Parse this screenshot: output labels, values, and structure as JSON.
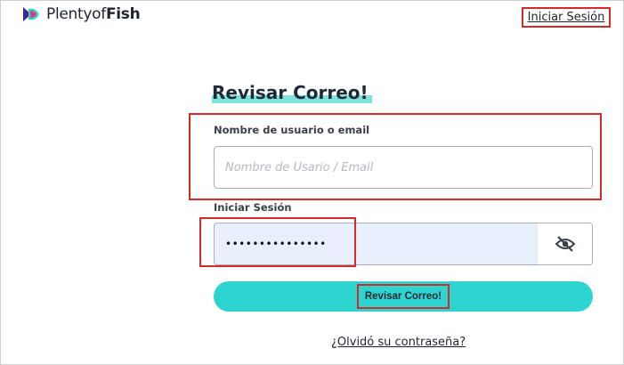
{
  "header": {
    "logo": {
      "brand_regular": "Plenty",
      "brand_of": "of",
      "brand_bold": "Fish",
      "icon": "fish-logo-icon"
    },
    "signin_link": "Iniciar Sesión"
  },
  "form": {
    "title": "Revisar Correo!",
    "username": {
      "label": "Nombre de usuario o email",
      "value": "",
      "placeholder": "Nombre de Usario / Email"
    },
    "password": {
      "label": "Iniciar Sesión",
      "masked_value": "•••••••••••••••",
      "toggle_icon": "eye-slash-icon"
    },
    "submit_label": "Revisar Correo!",
    "forgot_link": "¿Olvidó su contraseña?"
  },
  "colors": {
    "accent": "#2dd4d0",
    "title_highlight": "#7de3dc",
    "annotation_red": "#d42a2a",
    "autofill_bg": "#e8f0fe"
  }
}
